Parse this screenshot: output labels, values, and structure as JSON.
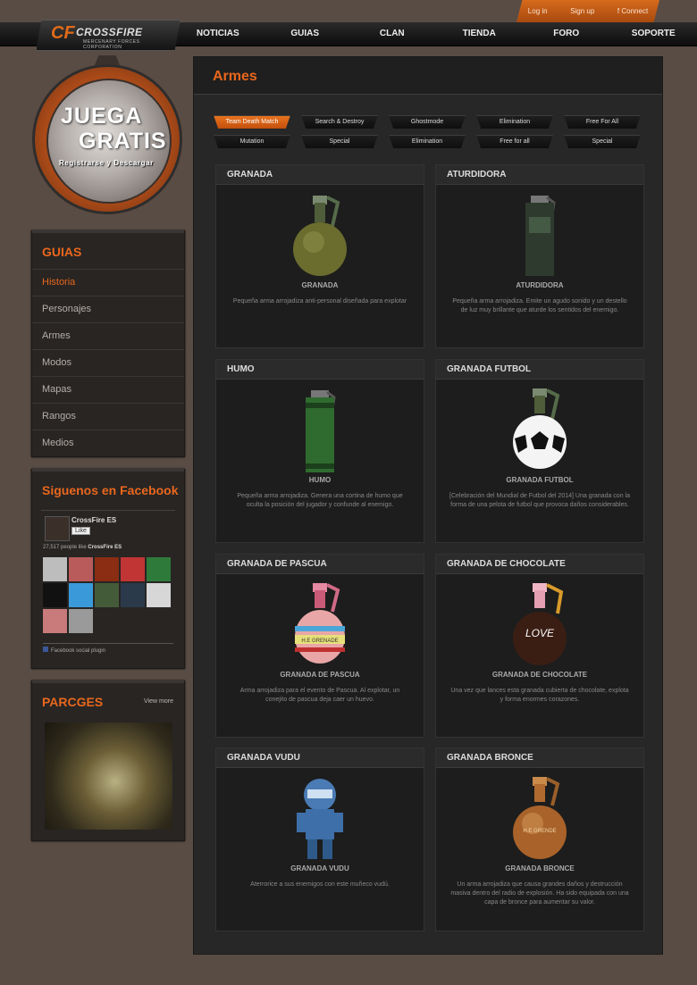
{
  "top_links": {
    "login": "Log in",
    "signup": "Sign up",
    "connect": "f Connect"
  },
  "logo": {
    "mark": "CF",
    "text": "CROSSFIRE",
    "sub": "MERCENARY FORCES CORPORATION"
  },
  "nav": [
    "NOTICIAS",
    "GUIAS",
    "CLAN",
    "TIENDA",
    "FORO",
    "SOPORTE"
  ],
  "promo": {
    "line1": "JUEGA",
    "line2": "GRATIS",
    "line3": "Registrarse y Descargar"
  },
  "sidebar": {
    "title": "GUIAS",
    "items": [
      "Historia",
      "Personajes",
      "Armes",
      "Modos",
      "Mapas",
      "Rangos",
      "Medios"
    ]
  },
  "facebook": {
    "title": "Siguenos en Facebook",
    "page_name": "CrossFire ES",
    "like": "Like",
    "count_prefix": "27,517 people like",
    "count_page": "CrossFire ES",
    "plugin": "Facebook social plugin"
  },
  "parcges": {
    "title": "PARCGES",
    "more": "View more"
  },
  "main": {
    "title": "Armes",
    "filters": [
      "Team Death Match",
      "Search & Destroy",
      "Ghostmode",
      "Elimination",
      "Free For All",
      "Mutation",
      "Special",
      "Elimination",
      "Free for all",
      "Special"
    ],
    "cards": [
      {
        "header": "GRANADA",
        "name": "GRANADA",
        "desc": "Pequeña arma arrojadiza anti-personal diseñada para explotar",
        "art": "olive-grenade"
      },
      {
        "header": "ATURDIDORA",
        "name": "ATURDIDORA",
        "desc": "Pequeña arma arrojadiza. Emite un agudo sonido y un destello de luz muy brillante que aturde los sentidos del enemigo.",
        "art": "stun-canister"
      },
      {
        "header": "HUMO",
        "name": "HUMO",
        "desc": "Pequeña arma arrojadiza. Genera una cortina de humo que oculta la posición del jugador y confunde al enemigo.",
        "art": "smoke-canister"
      },
      {
        "header": "GRANADA FUTBOL",
        "name": "GRANADA FUTBOL",
        "desc": "[Celebración del Mundial de Futbol del 2014] Una granada con la forma de una pelota de futbol que provoca daños considerables.",
        "art": "football-grenade"
      },
      {
        "header": "GRANADA DE PASCUA",
        "name": "GRANADA DE PASCUA",
        "desc": "Arma arrojadiza para el evento de Pascua. Al explotar, un conejito de pascua deja caer un huevo.",
        "art": "easter-grenade",
        "label": "H.E GRENADE"
      },
      {
        "header": "GRANADA DE CHOCOLATE",
        "name": "GRANADA DE CHOCOLATE",
        "desc": "Una vez que lances esta granada cubierta de chocolate, explota y forma enormes corazones.",
        "art": "chocolate-grenade",
        "label": "LOVE"
      },
      {
        "header": "GRANADA VUDU",
        "name": "GRANADA VUDU",
        "desc": "Aterrorice a sus enemigos con este muñeco vudú.",
        "art": "voodoo-doll"
      },
      {
        "header": "GRANADA BRONCE",
        "name": "GRANADA BRONCE",
        "desc": "Un arma arrojadiza que causa grandes daños y destrucción masiva dentro del radio de explosión. Ha sido equipada con una capa de bronce para aumentar su valor.",
        "art": "bronze-grenade",
        "label": "H.E GRENDE"
      }
    ]
  },
  "colors": {
    "accent": "#e9671d",
    "page_bg": "#594c45",
    "panel_bg": "#282523"
  }
}
